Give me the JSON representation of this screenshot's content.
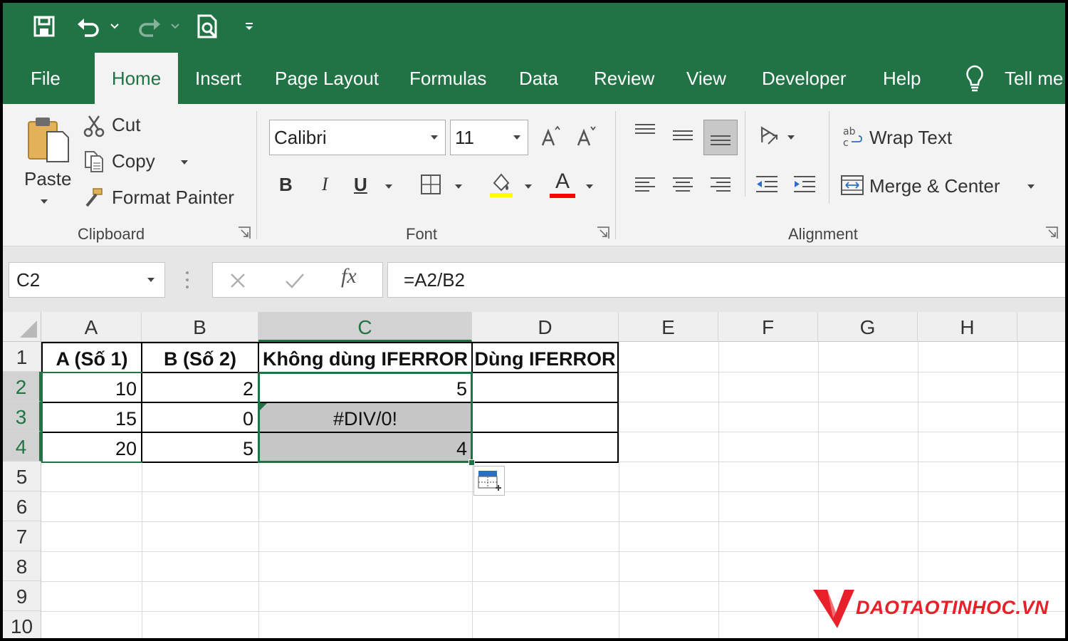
{
  "ribbon_tabs": [
    "File",
    "Home",
    "Insert",
    "Page Layout",
    "Formulas",
    "Data",
    "Review",
    "View",
    "Developer",
    "Help",
    "Tell me"
  ],
  "active_tab": "Home",
  "clipboard": {
    "paste": "Paste",
    "cut": "Cut",
    "copy": "Copy",
    "format_painter": "Format Painter",
    "group_label": "Clipboard"
  },
  "font": {
    "name": "Calibri",
    "size": "11",
    "group_label": "Font",
    "bold": "B",
    "italic": "I",
    "underline": "U",
    "font_color_glyph": "A",
    "fill_color": "#ffff00",
    "font_color": "#ff0000"
  },
  "alignment": {
    "wrap_text": "Wrap Text",
    "merge_center": "Merge & Center",
    "group_label": "Alignment"
  },
  "formula_bar": {
    "name_box": "C2",
    "formula": "=A2/B2",
    "fx": "fx"
  },
  "sheet": {
    "columns": [
      "A",
      "B",
      "C",
      "D",
      "E",
      "F",
      "G",
      "H"
    ],
    "selected_column": "C",
    "rows": [
      "1",
      "2",
      "3",
      "4",
      "5",
      "6",
      "7",
      "8",
      "9",
      "10"
    ],
    "selected_rows": [
      "2",
      "3",
      "4"
    ],
    "headers": {
      "a1": "A (Số 1)",
      "b1": "B (Số 2)",
      "c1": "Không dùng IFERROR",
      "d1": "Dùng IFERROR"
    },
    "data": [
      {
        "a": "10",
        "b": "2",
        "c": "5"
      },
      {
        "a": "15",
        "b": "0",
        "c": "#DIV/0!"
      },
      {
        "a": "20",
        "b": "5",
        "c": "4"
      }
    ]
  },
  "watermark": "DAOTAOTINHOC.VN",
  "colors": {
    "excel_green": "#217346",
    "selection_fill": "#c6c6c6",
    "logo_red": "#e8202a"
  }
}
